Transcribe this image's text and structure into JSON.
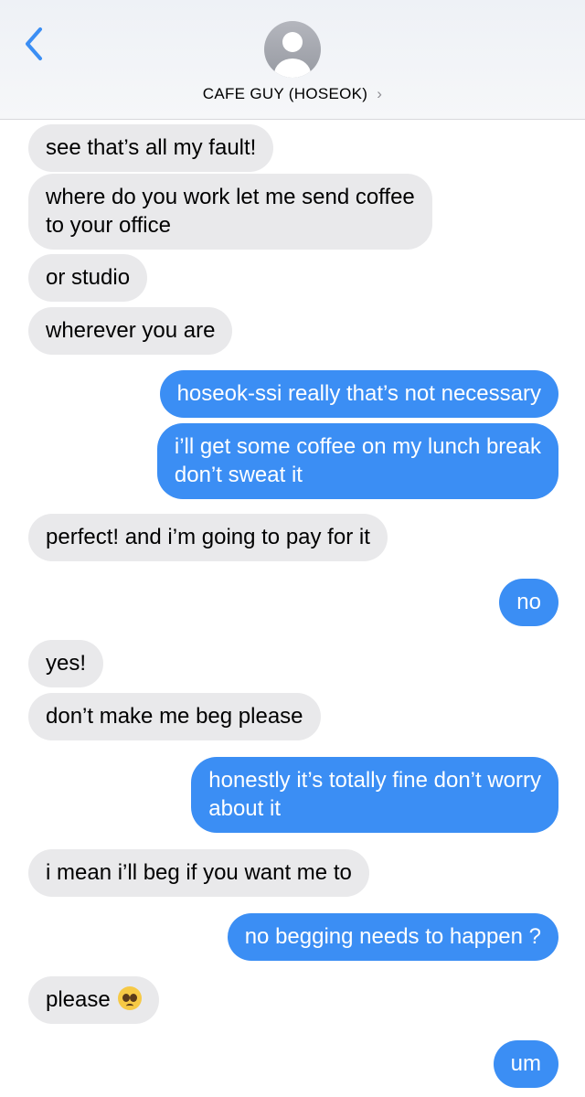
{
  "header": {
    "contact_name": "CAFE GUY (HOSEOK)",
    "chevron": "›"
  },
  "colors": {
    "incoming_bubble": "#e9e9eb",
    "outgoing_bubble": "#3b8ef4",
    "back_accent": "#3b8ef4"
  },
  "icons": {
    "back": "chevron-left-icon",
    "avatar": "person-silhouette-icon",
    "emoji": "pleading-face-emoji"
  },
  "messages": [
    {
      "from": "them",
      "text": "see that’s all my fault!"
    },
    {
      "from": "them",
      "line1": "where do you work let me send coffee",
      "line2": "to your office"
    },
    {
      "from": "them",
      "text": "or studio"
    },
    {
      "from": "them",
      "text": "wherever you are"
    },
    {
      "from": "me",
      "text": "hoseok-ssi really that’s not necessary"
    },
    {
      "from": "me",
      "line1": "i’ll get some coffee on my lunch break",
      "line2": "don’t sweat it"
    },
    {
      "from": "them",
      "text": "perfect! and i’m going to pay for it"
    },
    {
      "from": "me",
      "text": "no"
    },
    {
      "from": "them",
      "text": "yes!"
    },
    {
      "from": "them",
      "text": "don’t make me beg please"
    },
    {
      "from": "me",
      "line1": "honestly it’s totally fine don’t worry",
      "line2": "about it"
    },
    {
      "from": "them",
      "text": "i mean i’ll beg if you want me to"
    },
    {
      "from": "me",
      "text": "no begging needs to happen ?"
    },
    {
      "from": "them",
      "text": "please"
    },
    {
      "from": "me",
      "text": "um"
    }
  ]
}
